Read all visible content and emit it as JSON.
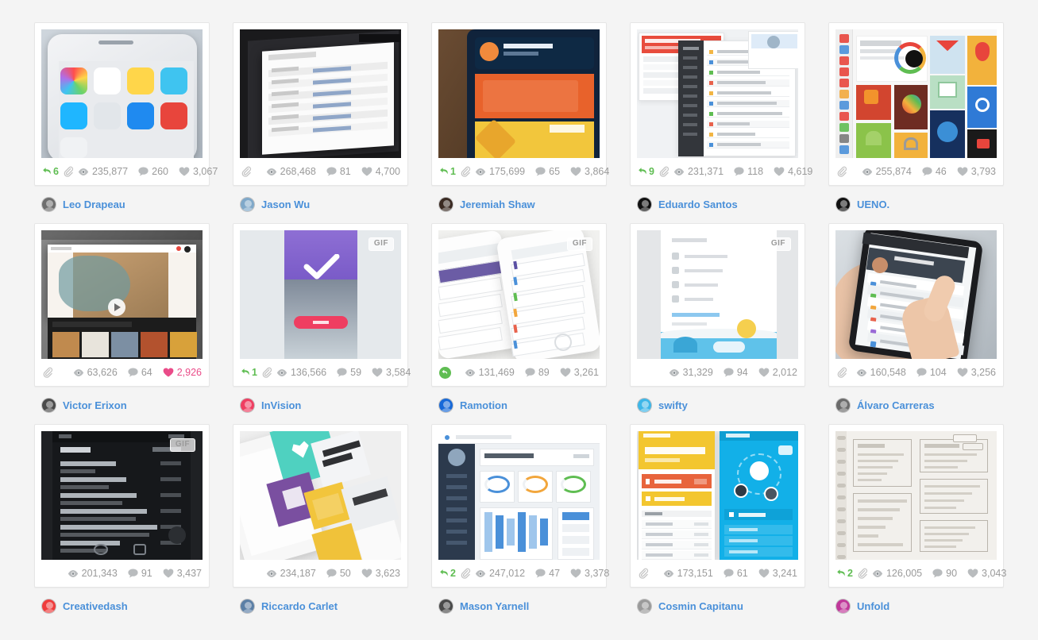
{
  "page": {
    "title": "Dribbble popular shots grid",
    "background": "#f4f4f4",
    "link_color": "#4a90d9",
    "rebound_color": "#5fbd52",
    "like_color": "#ea4c89"
  },
  "labels": {
    "gif_badge": "GIF"
  },
  "shots": [
    {
      "id": "shot-1",
      "author": "Leo Drapeau",
      "rebounds": "6",
      "has_rebound": true,
      "has_attachment": true,
      "views": "235,877",
      "comments": "260",
      "likes": "3,067",
      "liked": false,
      "gif": false,
      "art": "ios-phone",
      "avatar_color": "#6e6e6e"
    },
    {
      "id": "shot-2",
      "author": "Jason Wu",
      "rebounds": "",
      "has_rebound": false,
      "has_attachment": true,
      "views": "268,468",
      "comments": "81",
      "likes": "4,700",
      "liked": false,
      "gif": false,
      "art": "tablet-list",
      "avatar_color": "#7fa8c9"
    },
    {
      "id": "shot-3",
      "author": "Jeremiah Shaw",
      "rebounds": "1",
      "has_rebound": true,
      "has_attachment": true,
      "views": "175,699",
      "comments": "65",
      "likes": "3,864",
      "liked": false,
      "gif": false,
      "art": "dash-map",
      "avatar_color": "#3a2a22"
    },
    {
      "id": "shot-4",
      "author": "Eduardo Santos",
      "rebounds": "9",
      "has_rebound": true,
      "has_attachment": true,
      "views": "231,371",
      "comments": "118",
      "likes": "4,619",
      "liked": false,
      "gif": false,
      "art": "inbox-mock",
      "avatar_color": "#111111"
    },
    {
      "id": "shot-5",
      "author": "UENO.",
      "rebounds": "",
      "has_rebound": false,
      "has_attachment": true,
      "views": "255,874",
      "comments": "46",
      "likes": "3,793",
      "liked": false,
      "gif": false,
      "art": "google-cards",
      "avatar_color": "#111111"
    },
    {
      "id": "shot-6",
      "author": "Victor Erixon",
      "rebounds": "",
      "has_rebound": false,
      "has_attachment": true,
      "views": "63,626",
      "comments": "64",
      "likes": "2,926",
      "liked": true,
      "gif": false,
      "art": "newyork-video",
      "avatar_color": "#4a4a4a"
    },
    {
      "id": "shot-7",
      "author": "InVision",
      "rebounds": "1",
      "has_rebound": true,
      "has_attachment": true,
      "views": "136,566",
      "comments": "59",
      "likes": "3,584",
      "liked": false,
      "gif": true,
      "art": "check-login",
      "avatar_color": "#ef3e61"
    },
    {
      "id": "shot-8",
      "author": "Ramotion",
      "rebounds": "",
      "has_rebound": true,
      "has_attachment": false,
      "views": "131,469",
      "comments": "89",
      "likes": "3,261",
      "liked": false,
      "gif": true,
      "art": "phones-cards",
      "avatar_color": "#1769d8"
    },
    {
      "id": "shot-9",
      "author": "swifty",
      "rebounds": "",
      "has_rebound": false,
      "has_attachment": false,
      "views": "31,329",
      "comments": "94",
      "likes": "2,012",
      "liked": false,
      "gif": true,
      "art": "menu-illustr",
      "avatar_color": "#3db6e8"
    },
    {
      "id": "shot-10",
      "author": "Álvaro Carreras",
      "rebounds": "",
      "has_rebound": false,
      "has_attachment": true,
      "views": "160,548",
      "comments": "104",
      "likes": "3,256",
      "liked": false,
      "gif": false,
      "art": "hand-phone",
      "avatar_color": "#6b6b6b"
    },
    {
      "id": "shot-11",
      "author": "Creativedash",
      "rebounds": "",
      "has_rebound": false,
      "has_attachment": false,
      "views": "201,343",
      "comments": "91",
      "likes": "3,437",
      "liked": false,
      "gif": true,
      "art": "dark-inbox",
      "avatar_color": "#ef3c3c"
    },
    {
      "id": "shot-12",
      "author": "Riccardo Carlet",
      "rebounds": "",
      "has_rebound": false,
      "has_attachment": false,
      "views": "234,187",
      "comments": "50",
      "likes": "3,623",
      "liked": false,
      "gif": false,
      "art": "tiles-phone",
      "avatar_color": "#5b7fa6"
    },
    {
      "id": "shot-13",
      "author": "Mason Yarnell",
      "rebounds": "2",
      "has_rebound": true,
      "has_attachment": true,
      "views": "247,012",
      "comments": "47",
      "likes": "3,378",
      "liked": false,
      "gif": false,
      "art": "crm-dashboard",
      "avatar_color": "#4a4a4a"
    },
    {
      "id": "shot-14",
      "author": "Cosmin Capitanu",
      "rebounds": "",
      "has_rebound": false,
      "has_attachment": true,
      "views": "173,151",
      "comments": "61",
      "likes": "3,241",
      "liked": false,
      "gif": false,
      "art": "miles-app",
      "avatar_color": "#9a9a9a"
    },
    {
      "id": "shot-15",
      "author": "Unfold",
      "rebounds": "2",
      "has_rebound": true,
      "has_attachment": true,
      "views": "126,005",
      "comments": "90",
      "likes": "3,043",
      "liked": false,
      "gif": false,
      "art": "sketch-wire",
      "avatar_color": "#c0389a"
    }
  ]
}
